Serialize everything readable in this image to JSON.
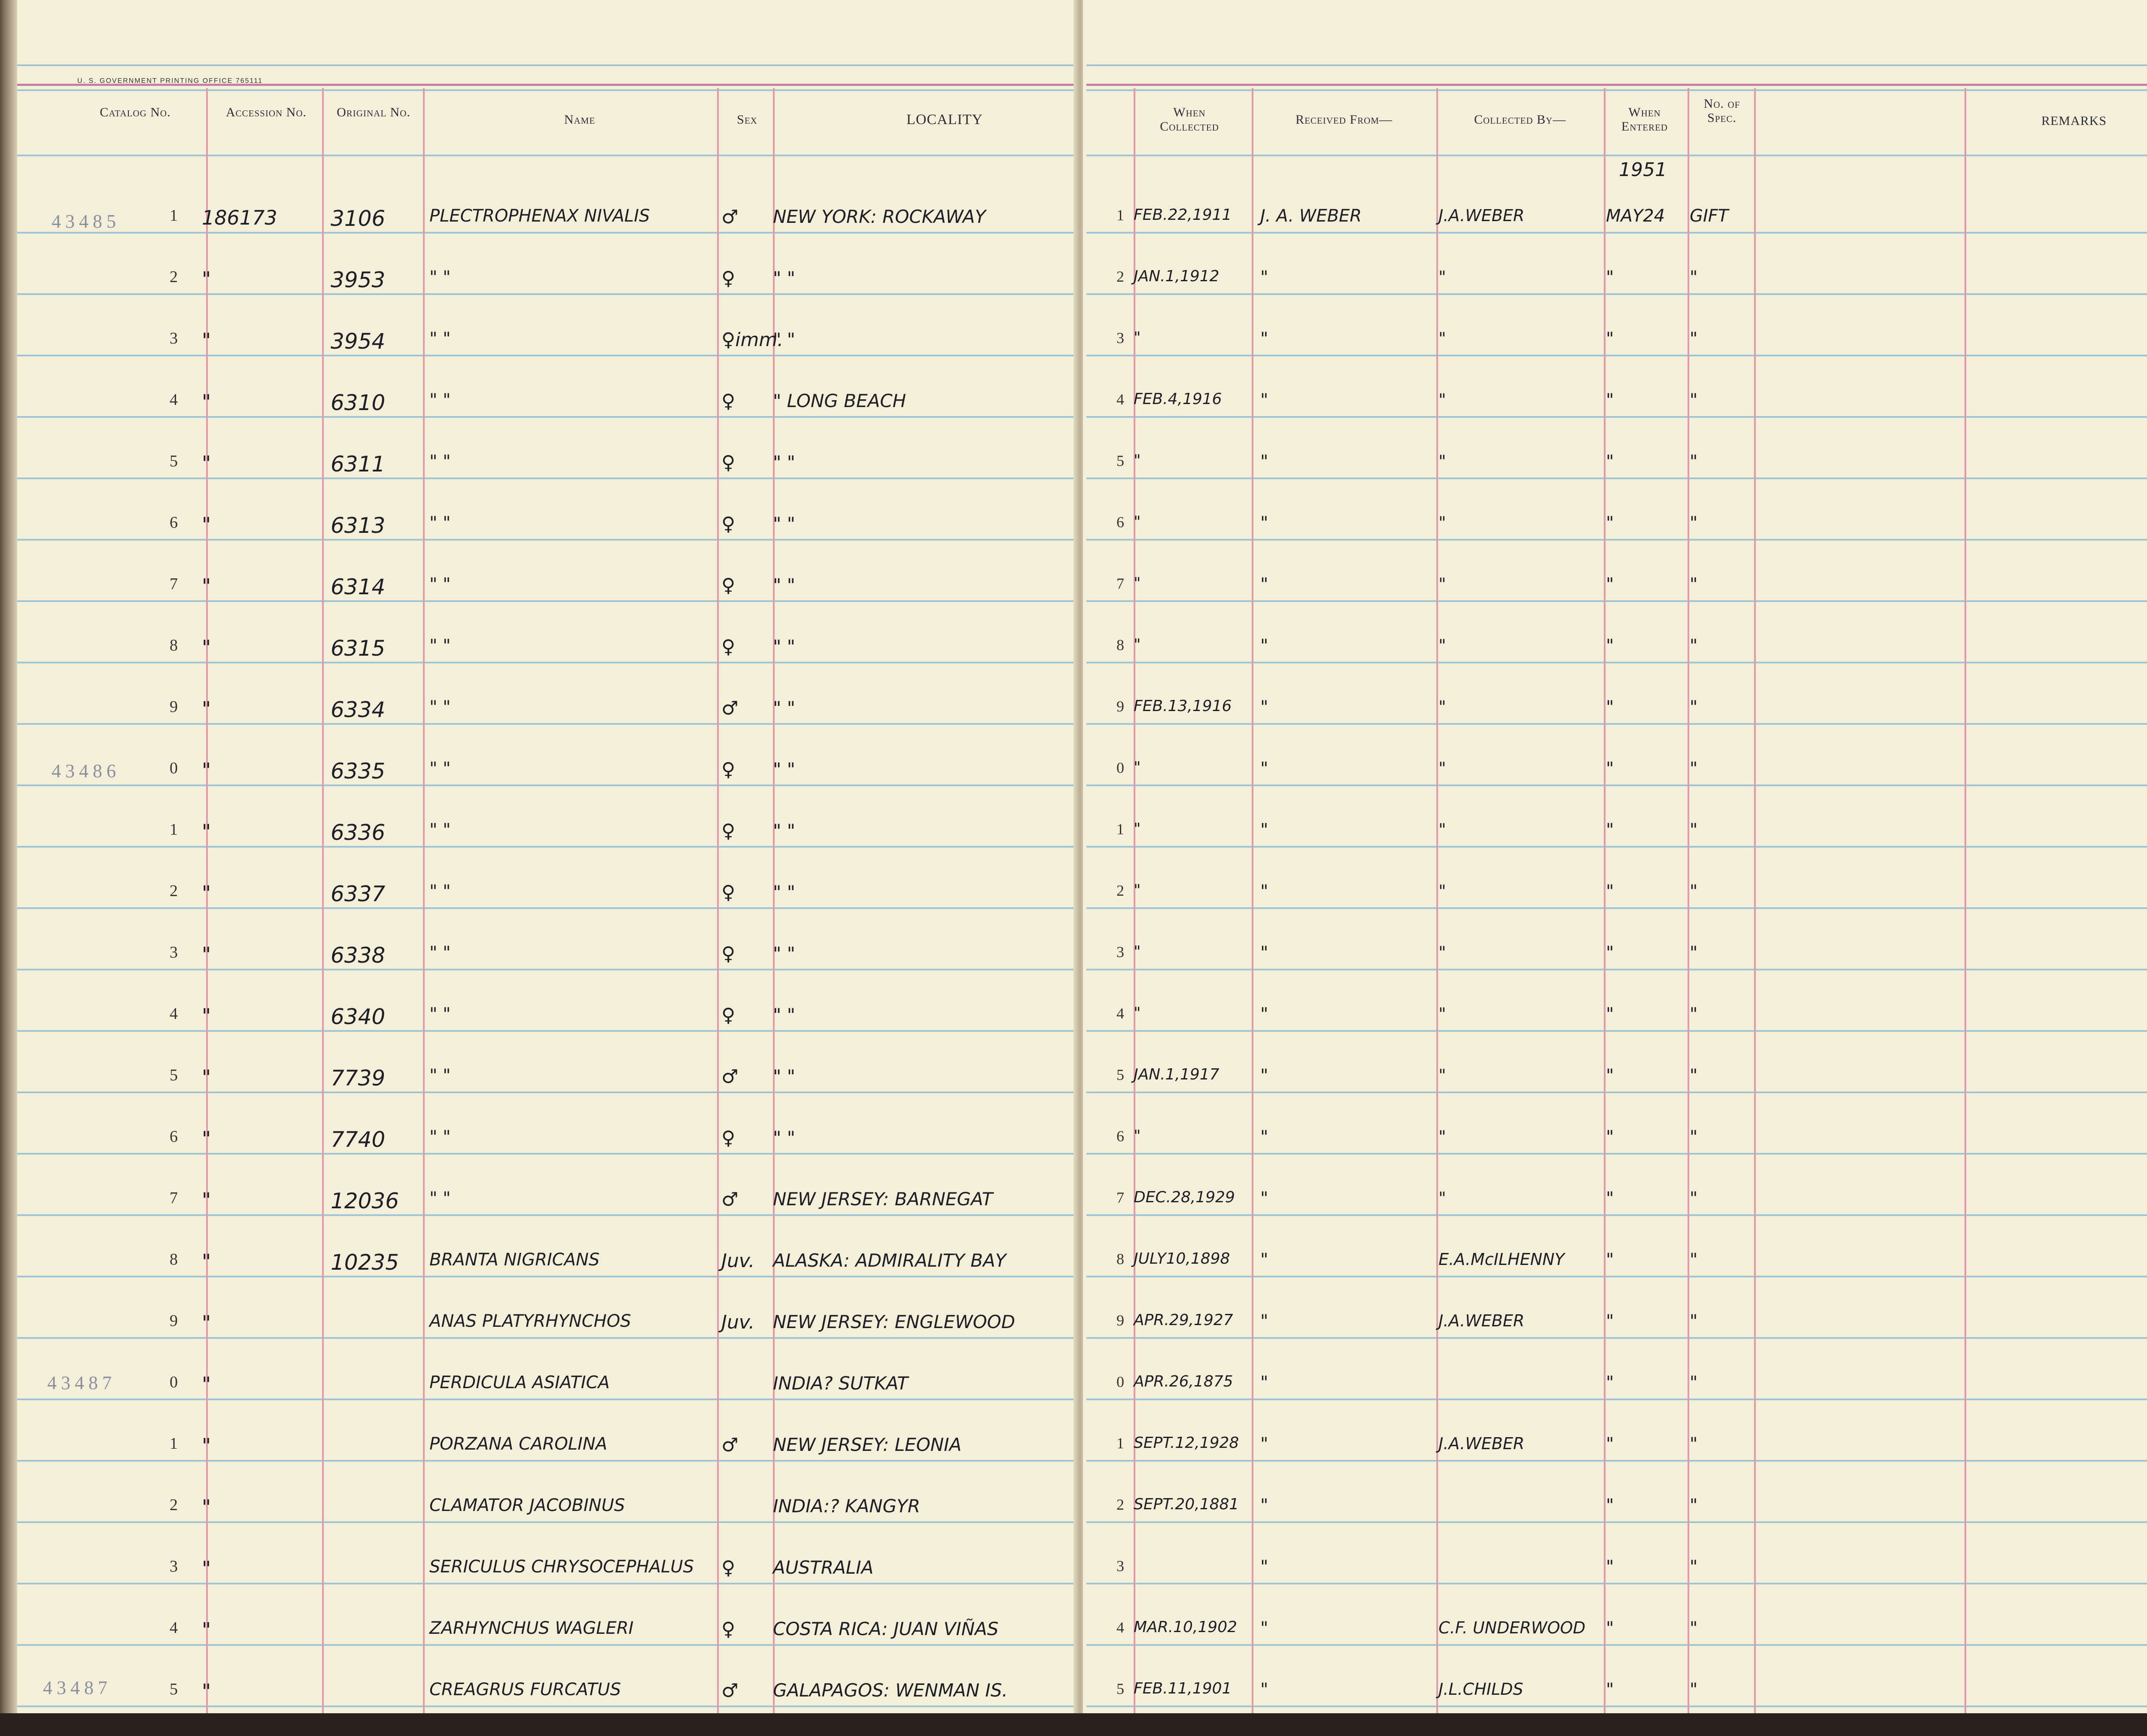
{
  "print_mark": "U. S. GOVERNMENT PRINTING OFFICE 765111",
  "headers": {
    "catalog_no": "Catalog No.",
    "accession_no": "Accession No.",
    "original_no": "Original No.",
    "name": "Name",
    "sex": "Sex",
    "locality": "LOCALITY",
    "when_collected": "When Collected",
    "received_from": "Received From—",
    "collected_by": "Collected By—",
    "when_entered": "When Entered",
    "no_of_spec": "No. of Spec.",
    "remarks": "REMARKS"
  },
  "entered_year": "1951",
  "catalog_stamps": [
    "43485",
    "43486",
    "43487",
    "43487"
  ],
  "rows": [
    {
      "n": "1",
      "acc": "186173",
      "orig": "3106",
      "name": "PLECTROPHENAX NIVALIS",
      "sex": "♂",
      "loc": "NEW YORK: ROCKAWAY",
      "rn": "1",
      "date": "FEB.22,1911",
      "rec": "J. A. WEBER",
      "coll": "J.A.WEBER",
      "entered": "MAY24",
      "spec": "GIFT"
    },
    {
      "n": "2",
      "acc": "\"",
      "orig": "3953",
      "name": "\"          \"",
      "sex": "♀",
      "loc": "\"              \"",
      "rn": "2",
      "date": "JAN.1,1912",
      "rec": "\"",
      "coll": "\"",
      "entered": "\"",
      "spec": "\""
    },
    {
      "n": "3",
      "acc": "\"",
      "orig": "3954",
      "name": "\"          \"",
      "sex": "♀imm.",
      "loc": "\"              \"",
      "rn": "3",
      "date": "\"",
      "rec": "\"",
      "coll": "\"",
      "entered": "\"",
      "spec": "\""
    },
    {
      "n": "4",
      "acc": "\"",
      "orig": "6310",
      "name": "\"          \"",
      "sex": "♀",
      "loc": "\"     LONG BEACH",
      "rn": "4",
      "date": "FEB.4,1916",
      "rec": "\"",
      "coll": "\"",
      "entered": "\"",
      "spec": "\""
    },
    {
      "n": "5",
      "acc": "\"",
      "orig": "6311",
      "name": "\"          \"",
      "sex": "♀",
      "loc": "\"              \"",
      "rn": "5",
      "date": "\"",
      "rec": "\"",
      "coll": "\"",
      "entered": "\"",
      "spec": "\""
    },
    {
      "n": "6",
      "acc": "\"",
      "orig": "6313",
      "name": "\"          \"",
      "sex": "♀",
      "loc": "\"              \"",
      "rn": "6",
      "date": "\"",
      "rec": "\"",
      "coll": "\"",
      "entered": "\"",
      "spec": "\""
    },
    {
      "n": "7",
      "acc": "\"",
      "orig": "6314",
      "name": "\"          \"",
      "sex": "♀",
      "loc": "\"              \"",
      "rn": "7",
      "date": "\"",
      "rec": "\"",
      "coll": "\"",
      "entered": "\"",
      "spec": "\""
    },
    {
      "n": "8",
      "acc": "\"",
      "orig": "6315",
      "name": "\"          \"",
      "sex": "♀",
      "loc": "\"              \"",
      "rn": "8",
      "date": "\"",
      "rec": "\"",
      "coll": "\"",
      "entered": "\"",
      "spec": "\""
    },
    {
      "n": "9",
      "acc": "\"",
      "orig": "6334",
      "name": "\"          \"",
      "sex": "♂",
      "loc": "\"              \"",
      "rn": "9",
      "date": "FEB.13,1916",
      "rec": "\"",
      "coll": "\"",
      "entered": "\"",
      "spec": "\""
    },
    {
      "n": "0",
      "acc": "\"",
      "orig": "6335",
      "name": "\"          \"",
      "sex": "♀",
      "loc": "\"              \"",
      "rn": "0",
      "date": "\"",
      "rec": "\"",
      "coll": "\"",
      "entered": "\"",
      "spec": "\""
    },
    {
      "n": "1",
      "acc": "\"",
      "orig": "6336",
      "name": "\"          \"",
      "sex": "♀",
      "loc": "\"              \"",
      "rn": "1",
      "date": "\"",
      "rec": "\"",
      "coll": "\"",
      "entered": "\"",
      "spec": "\""
    },
    {
      "n": "2",
      "acc": "\"",
      "orig": "6337",
      "name": "\"          \"",
      "sex": "♀",
      "loc": "\"              \"",
      "rn": "2",
      "date": "\"",
      "rec": "\"",
      "coll": "\"",
      "entered": "\"",
      "spec": "\""
    },
    {
      "n": "3",
      "acc": "\"",
      "orig": "6338",
      "name": "\"          \"",
      "sex": "♀",
      "loc": "\"              \"",
      "rn": "3",
      "date": "\"",
      "rec": "\"",
      "coll": "\"",
      "entered": "\"",
      "spec": "\""
    },
    {
      "n": "4",
      "acc": "\"",
      "orig": "6340",
      "name": "\"          \"",
      "sex": "♀",
      "loc": "\"              \"",
      "rn": "4",
      "date": "\"",
      "rec": "\"",
      "coll": "\"",
      "entered": "\"",
      "spec": "\""
    },
    {
      "n": "5",
      "acc": "\"",
      "orig": "7739",
      "name": "\"          \"",
      "sex": "♂",
      "loc": "\"              \"",
      "rn": "5",
      "date": "JAN.1,1917",
      "rec": "\"",
      "coll": "\"",
      "entered": "\"",
      "spec": "\""
    },
    {
      "n": "6",
      "acc": "\"",
      "orig": "7740",
      "name": "\"          \"",
      "sex": "♀",
      "loc": "\"              \"",
      "rn": "6",
      "date": "\"",
      "rec": "\"",
      "coll": "\"",
      "entered": "\"",
      "spec": "\""
    },
    {
      "n": "7",
      "acc": "\"",
      "orig": "12036",
      "name": "\"          \"",
      "sex": "♂",
      "loc": "NEW JERSEY: BARNEGAT",
      "rn": "7",
      "date": "DEC.28,1929",
      "rec": "\"",
      "coll": "\"",
      "entered": "\"",
      "spec": "\""
    },
    {
      "n": "8",
      "acc": "\"",
      "orig": "10235",
      "name": "BRANTA NIGRICANS",
      "sex": "Juv.",
      "loc": "ALASKA: ADMIRALITY BAY",
      "rn": "8",
      "date": "JULY10,1898",
      "rec": "\"",
      "coll": "E.A.McILHENNY",
      "entered": "\"",
      "spec": "\""
    },
    {
      "n": "9",
      "acc": "\"",
      "orig": "",
      "name": "ANAS PLATYRHYNCHOS",
      "sex": "Juv.",
      "loc": "NEW JERSEY: ENGLEWOOD",
      "rn": "9",
      "date": "APR.29,1927",
      "rec": "\"",
      "coll": "J.A.WEBER",
      "entered": "\"",
      "spec": "\""
    },
    {
      "n": "0",
      "acc": "\"",
      "orig": "",
      "name": "PERDICULA ASIATICA",
      "sex": "",
      "loc": "INDIA?  SUTKAT",
      "rn": "0",
      "date": "APR.26,1875",
      "rec": "\"",
      "coll": "",
      "entered": "\"",
      "spec": "\""
    },
    {
      "n": "1",
      "acc": "\"",
      "orig": "",
      "name": "PORZANA CAROLINA",
      "sex": "♂",
      "loc": "NEW JERSEY: LEONIA",
      "rn": "1",
      "date": "SEPT.12,1928",
      "rec": "\"",
      "coll": "J.A.WEBER",
      "entered": "\"",
      "spec": "\""
    },
    {
      "n": "2",
      "acc": "\"",
      "orig": "",
      "name": "CLAMATOR JACOBINUS",
      "sex": "",
      "loc": "INDIA:?  KANGYR",
      "rn": "2",
      "date": "SEPT.20,1881",
      "rec": "\"",
      "coll": "",
      "entered": "\"",
      "spec": "\""
    },
    {
      "n": "3",
      "acc": "\"",
      "orig": "",
      "name": "SERICULUS CHRYSOCEPHALUS",
      "sex": "♀",
      "loc": "AUSTRALIA",
      "rn": "3",
      "date": "",
      "rec": "\"",
      "coll": "",
      "entered": "\"",
      "spec": "\""
    },
    {
      "n": "4",
      "acc": "\"",
      "orig": "",
      "name": "ZARHYNCHUS WAGLERI",
      "sex": "♀",
      "loc": "COSTA RICA: JUAN VIÑAS",
      "rn": "4",
      "date": "MAR.10,1902",
      "rec": "\"",
      "coll": "C.F. UNDERWOOD",
      "entered": "\"",
      "spec": "\""
    },
    {
      "n": "5",
      "acc": "\"",
      "orig": "",
      "name": "CREAGRUS FURCATUS",
      "sex": "♂",
      "loc": "GALAPAGOS: WENMAN IS.",
      "rn": "5",
      "date": "FEB.11,1901",
      "rec": "\"",
      "coll": "J.L.CHILDS",
      "entered": "\"",
      "spec": "\""
    }
  ]
}
